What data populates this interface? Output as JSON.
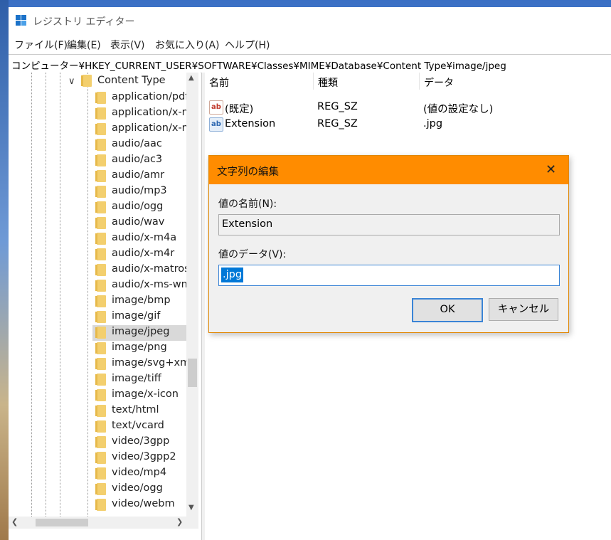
{
  "window": {
    "title": "レジストリ エディター",
    "menu": [
      "ファイル(F)",
      "編集(E)",
      "表示(V)",
      "お気に入り(A)",
      "ヘルプ(H)"
    ],
    "address": "コンピューター¥HKEY_CURRENT_USER¥SOFTWARE¥Classes¥MIME¥Database¥Content Type¥image/jpeg"
  },
  "tree": {
    "parent": "Content Type",
    "items": [
      "application/pdf",
      "application/x-m",
      "application/x-m",
      "audio/aac",
      "audio/ac3",
      "audio/amr",
      "audio/mp3",
      "audio/ogg",
      "audio/wav",
      "audio/x-m4a",
      "audio/x-m4r",
      "audio/x-matros",
      "audio/x-ms-wm",
      "image/bmp",
      "image/gif",
      "image/jpeg",
      "image/png",
      "image/svg+xml",
      "image/tiff",
      "image/x-icon",
      "text/html",
      "text/vcard",
      "video/3gpp",
      "video/3gpp2",
      "video/mp4",
      "video/ogg",
      "video/webm"
    ],
    "selected_item": "image/jpeg"
  },
  "list": {
    "columns": [
      "名前",
      "種類",
      "データ"
    ],
    "rows": [
      {
        "name": "(既定)",
        "type": "REG_SZ",
        "data": "(値の設定なし)",
        "icon": "string-value-icon"
      },
      {
        "name": "Extension",
        "type": "REG_SZ",
        "data": ".jpg",
        "icon": "string-value-icon"
      }
    ]
  },
  "dialog": {
    "title": "文字列の編集",
    "name_label": "値の名前(N):",
    "name_value": "Extension",
    "data_label": "値のデータ(V):",
    "data_value": ".jpg",
    "ok_label": "OK",
    "cancel_label": "キャンセル",
    "accent_color": "#ff8c00"
  }
}
